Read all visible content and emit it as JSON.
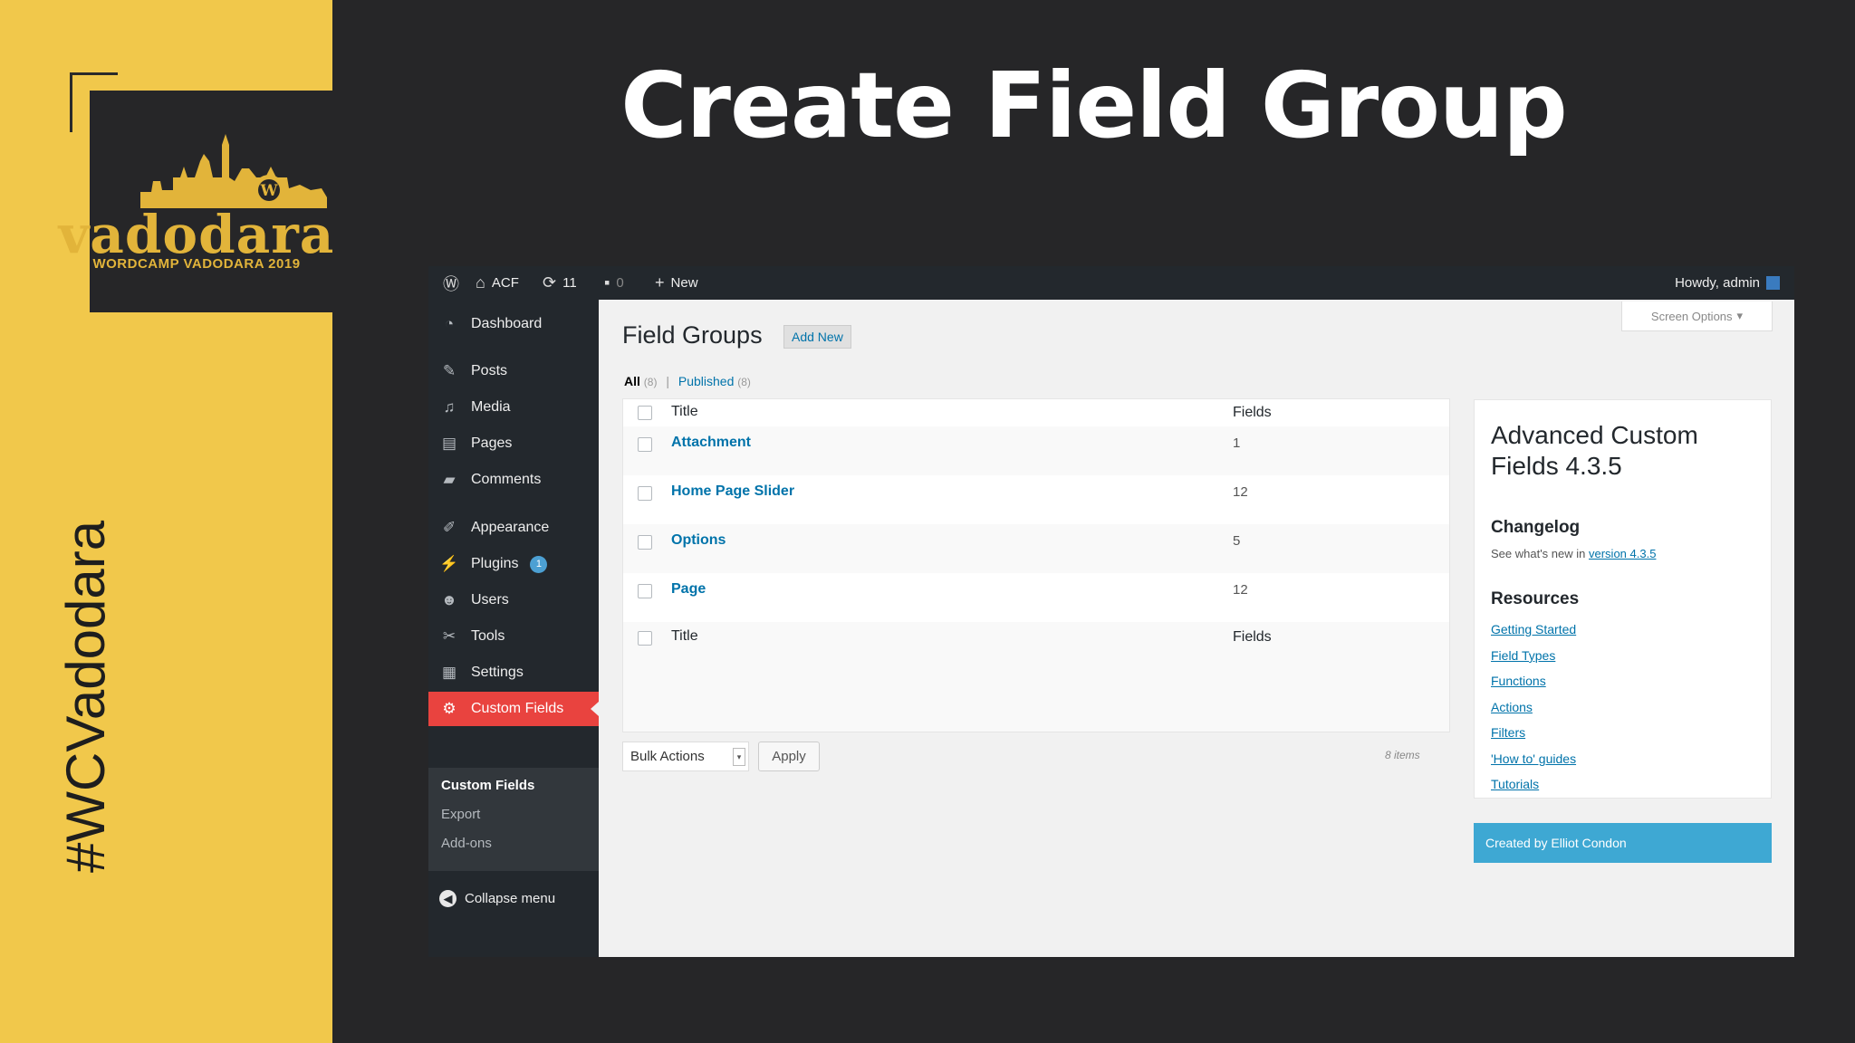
{
  "slide": {
    "title": "Create Field Group",
    "hashtag": "#WCVadodara",
    "logo": {
      "word": "vadodara",
      "subtitle": "WORDCAMP VADODARA 2019"
    }
  },
  "adminbar": {
    "site_name": "ACF",
    "updates_count": "11",
    "comments_count": "0",
    "new_label": "New",
    "howdy": "Howdy, admin"
  },
  "sidebar": {
    "items": [
      {
        "label": "Dashboard",
        "icon": "dashboard-icon"
      },
      {
        "label": "Posts",
        "icon": "pin-icon"
      },
      {
        "label": "Media",
        "icon": "media-icon"
      },
      {
        "label": "Pages",
        "icon": "pages-icon"
      },
      {
        "label": "Comments",
        "icon": "comment-icon"
      },
      {
        "label": "Appearance",
        "icon": "brush-icon"
      },
      {
        "label": "Plugins",
        "icon": "plug-icon",
        "badge": "1"
      },
      {
        "label": "Users",
        "icon": "user-icon"
      },
      {
        "label": "Tools",
        "icon": "wrench-icon"
      },
      {
        "label": "Settings",
        "icon": "settings-icon"
      },
      {
        "label": "Custom Fields",
        "icon": "gear-icon",
        "active": true
      }
    ],
    "submenu": [
      "Custom Fields",
      "Export",
      "Add-ons"
    ],
    "collapse_label": "Collapse menu"
  },
  "main": {
    "screen_options": "Screen Options",
    "page_title": "Field Groups",
    "add_new": "Add New",
    "filters": {
      "all": "All",
      "all_count": "(8)",
      "published": "Published",
      "published_count": "(8)"
    },
    "table": {
      "headers": {
        "title": "Title",
        "fields": "Fields"
      },
      "rows": [
        {
          "title": "Attachment",
          "fields": "1"
        },
        {
          "title": "Home Page Slider",
          "fields": "12"
        },
        {
          "title": "Options",
          "fields": "5"
        },
        {
          "title": "Page",
          "fields": "12"
        }
      ]
    },
    "bulk_actions": "Bulk Actions",
    "apply": "Apply",
    "items_count": "8 items"
  },
  "acf_box": {
    "title": "Advanced Custom Fields 4.3.5",
    "changelog_heading": "Changelog",
    "changelog_text": "See what's new in",
    "changelog_link": "version 4.3.5",
    "resources_heading": "Resources",
    "resources": [
      "Getting Started",
      "Field Types",
      "Functions",
      "Actions",
      "Filters",
      "'How to' guides",
      "Tutorials"
    ],
    "footer": "Created by Elliot Condon"
  },
  "colors": {
    "yellow": "#f1c84b",
    "dark": "#262628",
    "wp_admin": "#23282d",
    "active_red": "#e9433f",
    "link_blue": "#0073aa",
    "acf_blue": "#3ea8d3"
  }
}
